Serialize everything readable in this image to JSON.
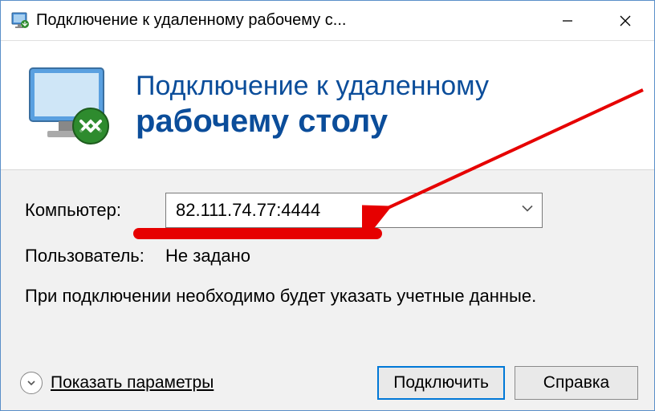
{
  "window": {
    "title": "Подключение к удаленному рабочему с..."
  },
  "header": {
    "line1": "Подключение к удаленному",
    "line2": "рабочему столу"
  },
  "form": {
    "computer_label": "Компьютер:",
    "computer_value": "82.111.74.77:4444",
    "user_label": "Пользователь:",
    "user_value": "Не задано",
    "hint": "При подключении необходимо будет указать учетные данные."
  },
  "footer": {
    "show_params": "Показать параметры",
    "connect": "Подключить",
    "help": "Справка"
  },
  "colors": {
    "accent": "#0b4d9a",
    "annotation": "#e60000"
  }
}
